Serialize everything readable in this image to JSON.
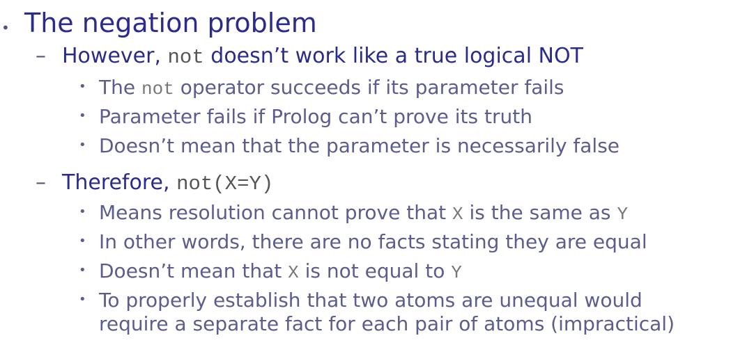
{
  "title": "The negation problem",
  "sections": [
    {
      "prefix": "However, ",
      "code": "not",
      "suffix": " doesn’t work like a true logical NOT",
      "items": [
        {
          "a": "The ",
          "code": "not",
          "b": " operator succeeds if its parameter fails"
        },
        {
          "a": "Parameter fails if Prolog can’t prove its truth"
        },
        {
          "a": "Doesn’t mean that the parameter is necessarily false"
        }
      ]
    },
    {
      "prefix": "Therefore, ",
      "code": "not(X=Y)",
      "items": [
        {
          "a": "Means resolution cannot prove that ",
          "code": "X",
          "b": " is the same as ",
          "code2": "Y"
        },
        {
          "a": "In other words, there are no facts stating they are equal"
        },
        {
          "a": "Doesn’t mean that ",
          "code": "X",
          "b": " is not equal to ",
          "code2": "Y"
        },
        {
          "a": "To properly establish that two atoms are unequal would",
          "line2": "require a separate fact for each pair of atoms (impractical)"
        }
      ]
    }
  ],
  "icons": {
    "bullet": "•",
    "dash": "–"
  }
}
